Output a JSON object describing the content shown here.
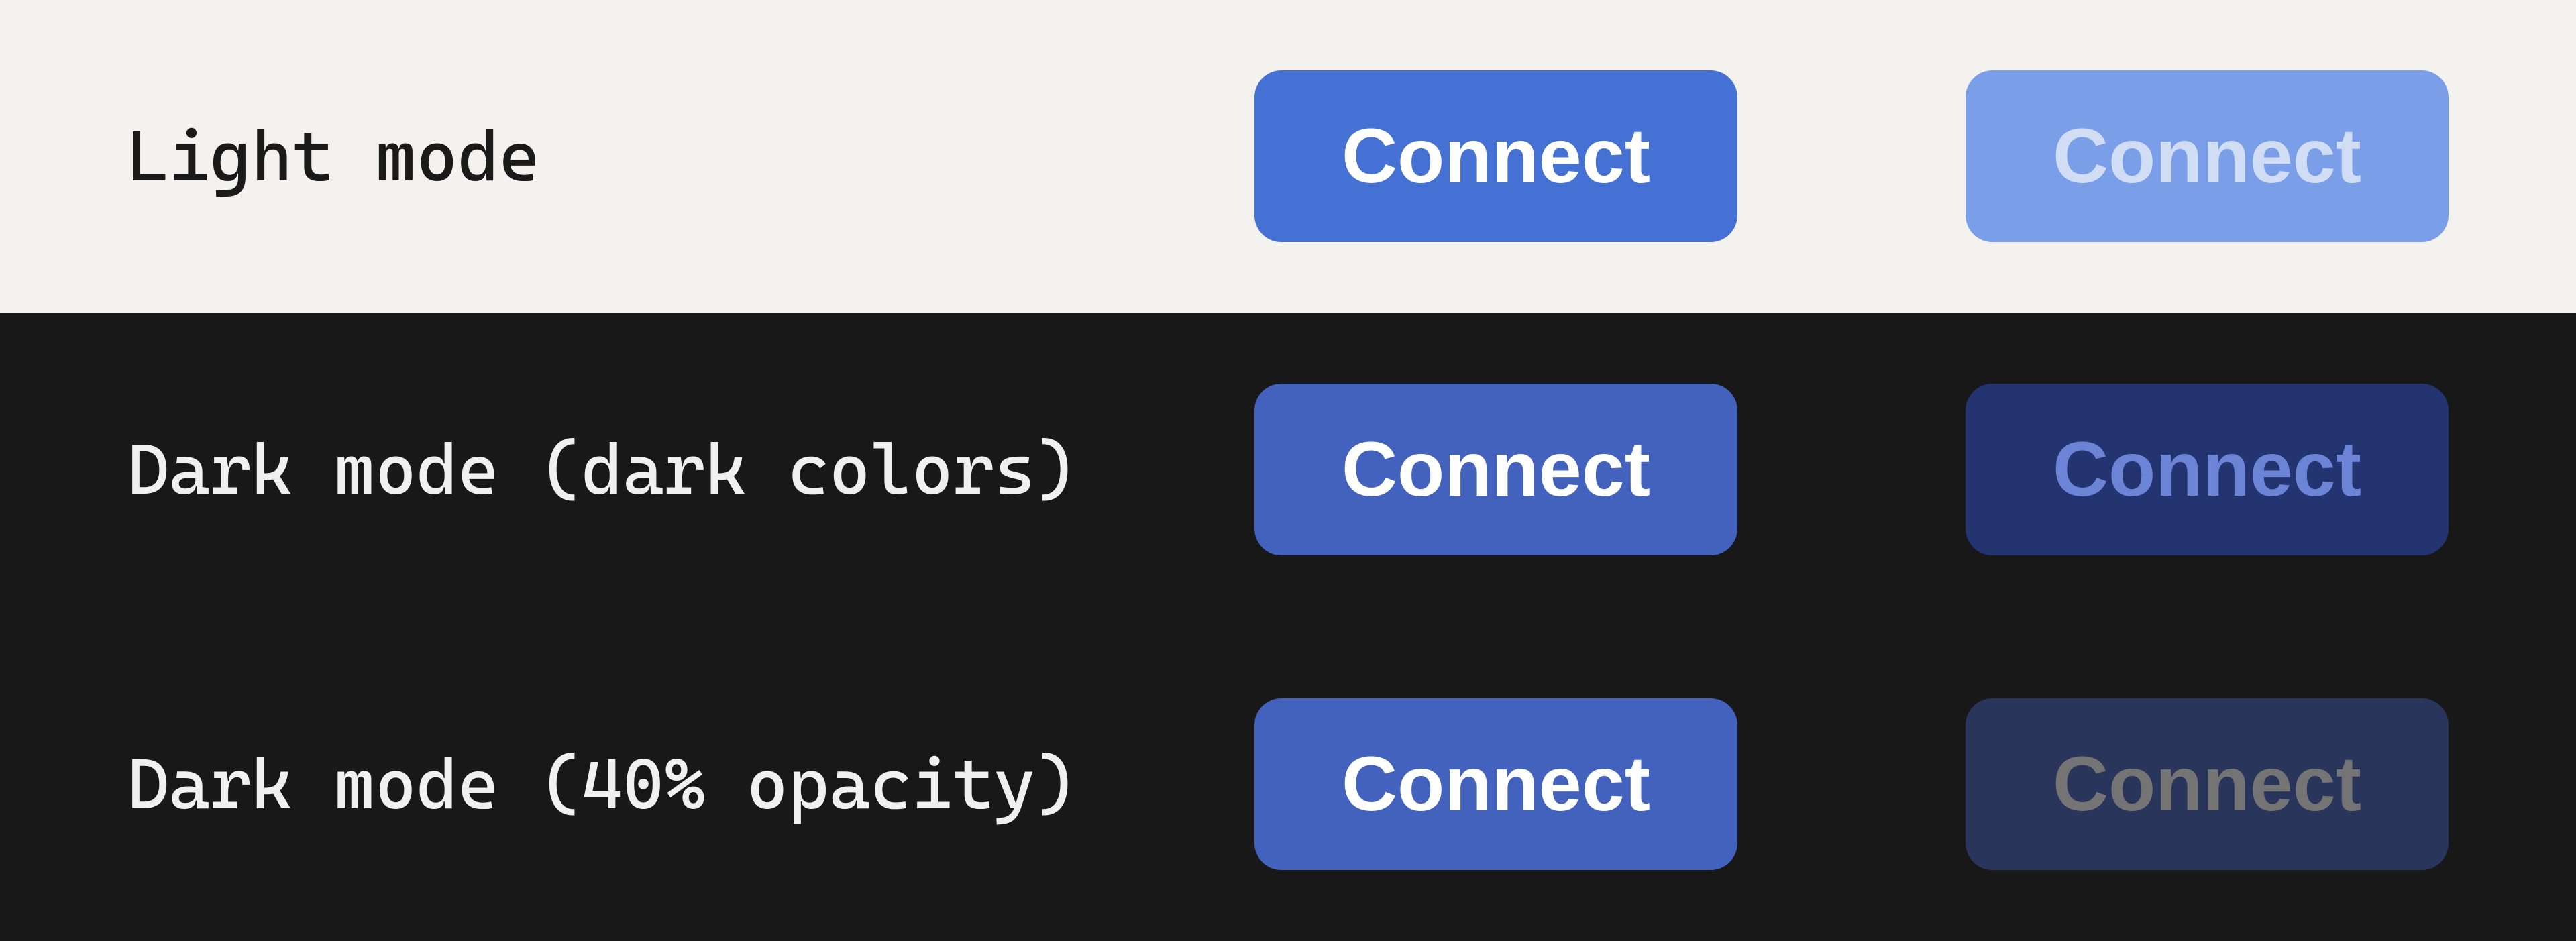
{
  "rows": [
    {
      "label": "Light mode",
      "buttons": {
        "enabled": "Connect",
        "disabled": "Connect"
      }
    },
    {
      "label": "Dark mode (dark colors)",
      "buttons": {
        "enabled": "Connect",
        "disabled": "Connect"
      }
    },
    {
      "label": "Dark mode (40% opacity)",
      "buttons": {
        "enabled": "Connect",
        "disabled": "Connect"
      }
    }
  ],
  "colors": {
    "light_bg": "#f3f2ef",
    "dark_bg": "#181818",
    "btn_light_enabled_bg": "#4570d4",
    "btn_light_disabled_bg": "#7a9ee7",
    "btn_dark_enabled_bg": "#4362bd",
    "btn_dark_disabled_bg": "#233470",
    "opacity_value": 0.4
  }
}
